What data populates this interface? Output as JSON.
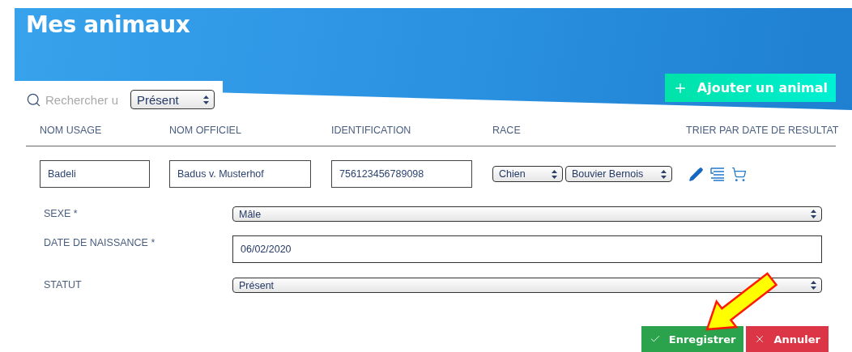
{
  "page": {
    "title": "Mes animaux"
  },
  "toolbar": {
    "search": {
      "placeholder": "Rechercher u"
    },
    "status_filter": {
      "value": "Présent"
    },
    "add_button": {
      "label": "Ajouter un animal"
    }
  },
  "table": {
    "columns": [
      "NOM USAGE",
      "NOM OFFICIEL",
      "IDENTIFICATION",
      "RACE",
      "TRIER PAR DATE DE RESULTAT"
    ],
    "rows": [
      {
        "nom_usage": "Badeli",
        "nom_officiel": "Badus v. Musterhof",
        "identification": "756123456789098",
        "espece": "Chien",
        "race": "Bouvier Bernois"
      }
    ]
  },
  "form": {
    "fields": [
      {
        "label": "SEXE *",
        "kind": "select",
        "value": "Mâle"
      },
      {
        "label": "DATE DE NAISSANCE *",
        "kind": "input",
        "value": "06/02/2020"
      },
      {
        "label": "STATUT",
        "kind": "select",
        "value": "Présent"
      }
    ]
  },
  "actions": [
    {
      "kind": "confirm",
      "label": "Enregistrer"
    },
    {
      "kind": "cancel",
      "label": "Annuler"
    }
  ]
}
